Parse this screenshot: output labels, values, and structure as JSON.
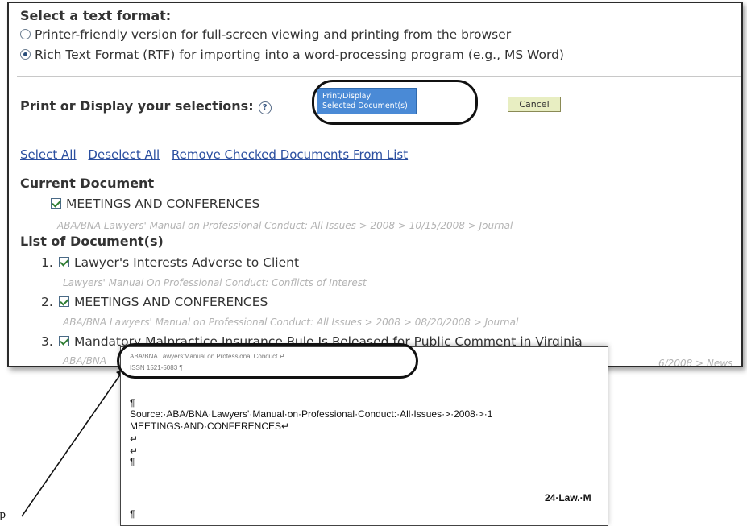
{
  "format_section": {
    "title": "Select a text format:",
    "options": [
      {
        "label": "Printer-friendly version for full-screen viewing and printing from the browser",
        "selected": false
      },
      {
        "label": "Rich Text Format (RTF) for importing into a word-processing program (e.g., MS Word)",
        "selected": true
      }
    ]
  },
  "print_section": {
    "label": "Print or Display your selections:",
    "help_icon": "?",
    "print_button": {
      "line1": "Print/Display",
      "line2": "Selected Document(s)"
    },
    "cancel_button": "Cancel"
  },
  "links": {
    "select_all": "Select All",
    "deselect_all": "Deselect All",
    "remove_checked": "Remove Checked Documents From List"
  },
  "current_document": {
    "heading": "Current Document",
    "title": "MEETINGS AND CONFERENCES",
    "path": "ABA/BNA Lawyers' Manual on Professional Conduct: All Issues > 2008 > 10/15/2008 > Journal"
  },
  "document_list": {
    "heading": "List of Document(s)",
    "items": [
      {
        "num": "1.",
        "title": "Lawyer's Interests Adverse to Client",
        "path": "Lawyers' Manual On Professional Conduct: Conflicts of Interest"
      },
      {
        "num": "2.",
        "title": "MEETINGS AND CONFERENCES",
        "path": "ABA/BNA Lawyers' Manual on Professional Conduct: All Issues > 2008 > 08/20/2008 > Journal"
      },
      {
        "num": "3.",
        "title": "Mandatory Malpractice Insurance Rule Is Released for Public Comment in Virginia",
        "path": "ABA/BNA"
      }
    ],
    "item3_path_tail": "6/2008 > News"
  },
  "rtf_preview": {
    "header_line1": "ABA/BNA Lawyers'Manual on Professional Conduct ↵",
    "header_line2": "ISSN 1521-5083 ¶",
    "pilcrow": "¶",
    "source_line": "Source:·ABA/BNA·Lawyers'·Manual·on·Professional·Conduct:·All·Issues·>·2008·>·1",
    "title_line": "MEETINGS·AND·CONFERENCES↵",
    "return_mark": "↵",
    "right_text": "24·Law.·M"
  },
  "crop_label": "op",
  "colors": {
    "link": "#2b4fa0",
    "print_button": "#4a8ad6",
    "cancel_button": "#e8eec2"
  }
}
